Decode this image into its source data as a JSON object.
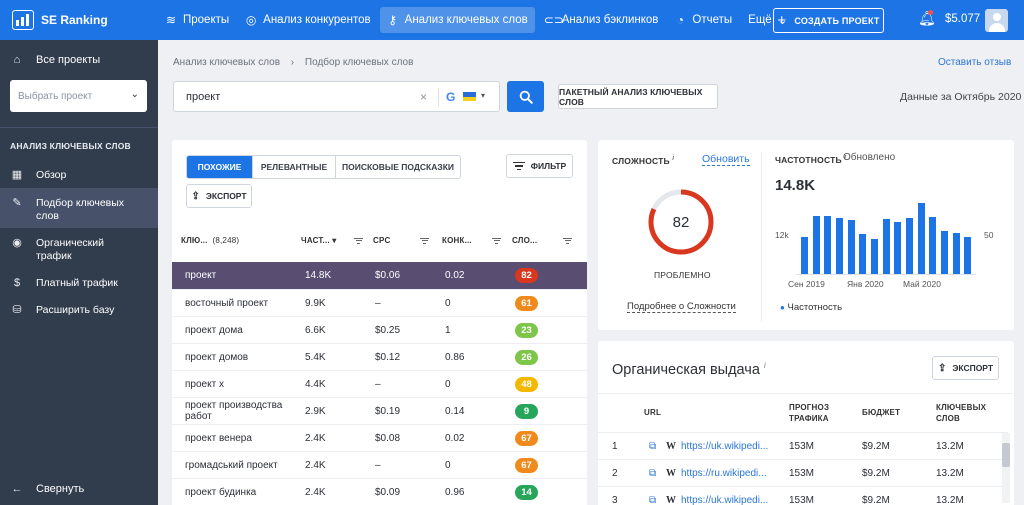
{
  "app": {
    "name": "SE Ranking"
  },
  "topnav": [
    {
      "label": "Проекты",
      "icon": "layers-icon",
      "glyph": "≋"
    },
    {
      "label": "Анализ конкурентов",
      "icon": "target-icon",
      "glyph": "◎"
    },
    {
      "label": "Анализ ключевых слов",
      "icon": "key-icon",
      "glyph": "⚷",
      "active": true
    },
    {
      "label": "Анализ бэклинков",
      "icon": "link-icon",
      "glyph": "⊂⊃"
    },
    {
      "label": "Отчеты",
      "icon": "clock-icon",
      "glyph": "◔"
    },
    {
      "label": "Ещё",
      "icon": "chevron-down-icon",
      "glyph": "⌄"
    }
  ],
  "create_project": "СОЗДАТЬ ПРОЕКТ",
  "balance": "$5.077",
  "sidebar": {
    "all_projects": "Все проекты",
    "project_select": "Выбрать проект",
    "section_title": "АНАЛИЗ КЛЮЧЕВЫХ СЛОВ",
    "items": [
      {
        "label": "Обзор",
        "icon": "grid-icon",
        "glyph": "▦"
      },
      {
        "label": "Подбор ключевых слов",
        "icon": "pencil-icon",
        "glyph": "✎",
        "active": true
      },
      {
        "label": "Органический трафик",
        "icon": "circle-target-icon",
        "glyph": "◉"
      },
      {
        "label": "Платный трафик",
        "icon": "dollar-icon",
        "glyph": "$"
      },
      {
        "label": "Расширить базу",
        "icon": "database-icon",
        "glyph": "⛁"
      }
    ],
    "collapse": "Свернуть"
  },
  "breadcrumb": {
    "parent": "Анализ ключевых слов",
    "current": "Подбор ключевых слов"
  },
  "feedback": "Оставить отзыв",
  "search": {
    "value": "проект",
    "engine": "G"
  },
  "batch_button": "ПАКЕТНЫЙ АНАЛИЗ КЛЮЧЕВЫХ СЛОВ",
  "data_date": "Данные за Октябрь 2020",
  "keywords": {
    "tabs": [
      "ПОХОЖИЕ",
      "РЕЛЕВАНТНЫЕ",
      "ПОИСКОВЫЕ ПОДСКАЗКИ"
    ],
    "filter": "ФИЛЬТР",
    "export": "ЭКСПОРТ",
    "headers": {
      "keyword": "КЛЮ...",
      "count": "(8,248)",
      "volume": "ЧАСТ...",
      "cpc": "CPC",
      "competition": "КОНК...",
      "difficulty": "СЛО..."
    },
    "rows": [
      {
        "kw": "проект",
        "vol": "14.8K",
        "cpc": "$0.06",
        "comp": "0.02",
        "diff": "82",
        "color": "#d9381e"
      },
      {
        "kw": "восточный проект",
        "vol": "9.9K",
        "cpc": "–",
        "comp": "0",
        "diff": "61",
        "color": "#f08a1c"
      },
      {
        "kw": "проект дома",
        "vol": "6.6K",
        "cpc": "$0.25",
        "comp": "1",
        "diff": "23",
        "color": "#7ec64a"
      },
      {
        "kw": "проект домов",
        "vol": "5.4K",
        "cpc": "$0.12",
        "comp": "0.86",
        "diff": "26",
        "color": "#7ec64a"
      },
      {
        "kw": "проект х",
        "vol": "4.4K",
        "cpc": "–",
        "comp": "0",
        "diff": "48",
        "color": "#f5b800"
      },
      {
        "kw": "проект производства работ",
        "vol": "2.9K",
        "cpc": "$0.19",
        "comp": "0.14",
        "diff": "9",
        "color": "#27a55a"
      },
      {
        "kw": "проект венера",
        "vol": "2.4K",
        "cpc": "$0.08",
        "comp": "0.02",
        "diff": "67",
        "color": "#f08a1c"
      },
      {
        "kw": "громадський проект",
        "vol": "2.4K",
        "cpc": "–",
        "comp": "0",
        "diff": "67",
        "color": "#f08a1c"
      },
      {
        "kw": "проект будинка",
        "vol": "2.4K",
        "cpc": "$0.09",
        "comp": "0.96",
        "diff": "14",
        "color": "#27a55a"
      }
    ]
  },
  "difficulty": {
    "label": "СЛОЖНОСТЬ",
    "info": "i",
    "update": "Обновить",
    "value": "82",
    "fraction": 0.82,
    "verdict": "ПРОБЛЕМНО",
    "more": "Подробнее о Сложности",
    "color": "#d9381e"
  },
  "frequency": {
    "label": "ЧАСТОТНОСТЬ",
    "info": "i",
    "status": "Обновлено",
    "value": "14.8K",
    "left_axis": "12k",
    "right_axis": "50",
    "xticks": [
      "Сен 2019",
      "Янв 2020",
      "Май 2020"
    ],
    "legend": "Частотность",
    "bar_color": "#1d74e5"
  },
  "chart_data": {
    "type": "bar",
    "title": "",
    "ylim": [
      0,
      22000
    ],
    "values": [
      9800,
      15500,
      15500,
      15000,
      14500,
      10800,
      9500,
      14800,
      14000,
      15000,
      19000,
      15300,
      11500,
      11000,
      10000
    ]
  },
  "organic": {
    "title": "Органическая выдача",
    "info": "i",
    "export": "ЭКСПОРТ",
    "headers": {
      "url": "URL",
      "traffic_1": "ПРОГНОЗ",
      "traffic_2": "ТРАФИКА",
      "budget": "БЮДЖЕТ",
      "kw_1": "КЛЮЧЕВЫХ",
      "kw_2": "СЛОВ"
    },
    "rows": [
      {
        "pos": "1",
        "url": "https://uk.wikipedi...",
        "traffic": "153M",
        "budget": "$9.2M",
        "keywords": "13.2M"
      },
      {
        "pos": "2",
        "url": "https://ru.wikipedi...",
        "traffic": "153M",
        "budget": "$9.2M",
        "keywords": "13.2M"
      },
      {
        "pos": "3",
        "url": "https://uk.wikipedi...",
        "traffic": "153M",
        "budget": "$9.2M",
        "keywords": "13.2M"
      }
    ]
  }
}
